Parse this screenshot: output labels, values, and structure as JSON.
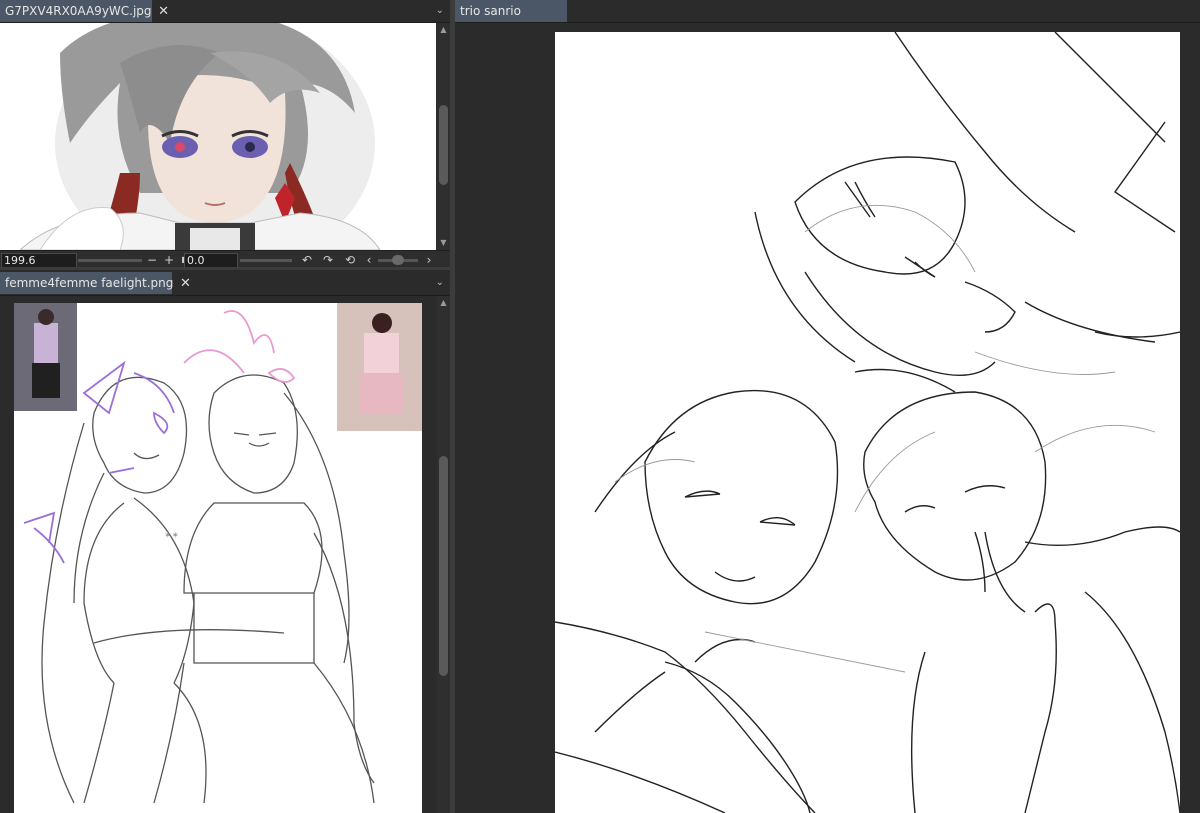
{
  "top_left_pane": {
    "tab_label": "G7PXV4RX0AA9yWC.jpg",
    "close_glyph": "✕",
    "menu_glyph": "⌄",
    "status": {
      "zoom_value": "199.6",
      "rotation_value": "0.0",
      "zoom_out_glyph": "−",
      "zoom_in_glyph": "+",
      "fit_glyph": "■",
      "undo_glyph": "↶",
      "redo_glyph": "↷",
      "reset_glyph": "⟲",
      "prev_glyph": "‹",
      "next_glyph": "›"
    }
  },
  "bottom_left_pane": {
    "tab_label": "femme4femme faelight.png",
    "close_glyph": "✕",
    "menu_glyph": "⌄"
  },
  "right_pane": {
    "tab_label": "trio sanrio"
  },
  "icons": {
    "scroll_up": "▲",
    "scroll_down": "▼",
    "close": "close-icon",
    "menu": "chevron-down-icon"
  },
  "colors": {
    "active_tab": "#4b5666",
    "workspace_bg": "#2b2b2b",
    "canvas": "#ffffff",
    "sketch_purple": "#9a70d8",
    "sketch_pink": "#e89ad0"
  }
}
